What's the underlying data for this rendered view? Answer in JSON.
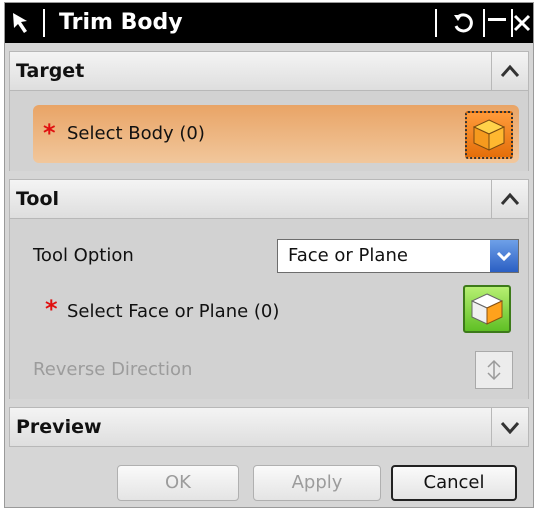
{
  "window": {
    "title": "Trim Body"
  },
  "target": {
    "header": "Target",
    "select_label": "Select Body (0)",
    "required_marker": "*"
  },
  "tool": {
    "header": "Tool",
    "option_label": "Tool Option",
    "option_value": "Face or Plane",
    "select_label": "Select Face or Plane (0)",
    "required_marker": "*",
    "reverse_label": "Reverse Direction"
  },
  "preview": {
    "header": "Preview"
  },
  "buttons": {
    "ok": "OK",
    "apply": "Apply",
    "cancel": "Cancel"
  },
  "colors": {
    "title_bar": "#000000",
    "highlight_row": "#e9a466",
    "required_star": "#e01010",
    "dropdown_arrow": "#2b5fc3"
  },
  "icons": {
    "titlebar_left": "select-arrow-icon",
    "reset": "reset-icon",
    "minimize": "minimize-icon",
    "close": "close-icon",
    "collapse": "chevron-up-icon",
    "expand": "chevron-down-icon",
    "body_selector": "solid-body-icon",
    "face_selector": "face-icon",
    "reverse": "reverse-direction-icon"
  }
}
